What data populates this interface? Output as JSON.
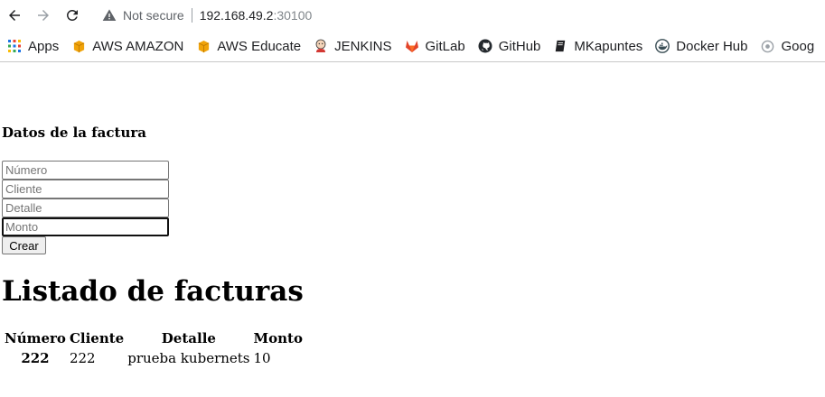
{
  "browser": {
    "security_label": "Not secure",
    "url_host": "192.168.49.2",
    "url_port": ":30100",
    "bookmarks": [
      {
        "label": "Apps",
        "icon": "apps-grid-icon"
      },
      {
        "label": "AWS AMAZON",
        "icon": "aws-box-icon"
      },
      {
        "label": "AWS Educate",
        "icon": "aws-box-icon"
      },
      {
        "label": "JENKINS",
        "icon": "jenkins-icon"
      },
      {
        "label": "GitLab",
        "icon": "gitlab-icon"
      },
      {
        "label": "GitHub",
        "icon": "github-icon"
      },
      {
        "label": "MKapuntes",
        "icon": "book-icon"
      },
      {
        "label": "Docker Hub",
        "icon": "docker-icon"
      },
      {
        "label": "Goog",
        "icon": "google-icon"
      }
    ]
  },
  "form": {
    "title": "Datos de la factura",
    "numero_placeholder": "Número",
    "cliente_placeholder": "Cliente",
    "detalle_placeholder": "Detalle",
    "monto_placeholder": "Monto",
    "submit_label": "Crear"
  },
  "list": {
    "title": "Listado de facturas",
    "headers": [
      "Número",
      "Cliente",
      "Detalle",
      "Monto"
    ],
    "rows": [
      {
        "numero": "222",
        "cliente": "222",
        "detalle": "prueba kubernets",
        "monto": "10"
      }
    ]
  },
  "colors": {
    "chrome_icon": "#5f6368",
    "aws": "#f0a30a",
    "gitlab": "#e24329",
    "divider": "#c8c8c8"
  }
}
